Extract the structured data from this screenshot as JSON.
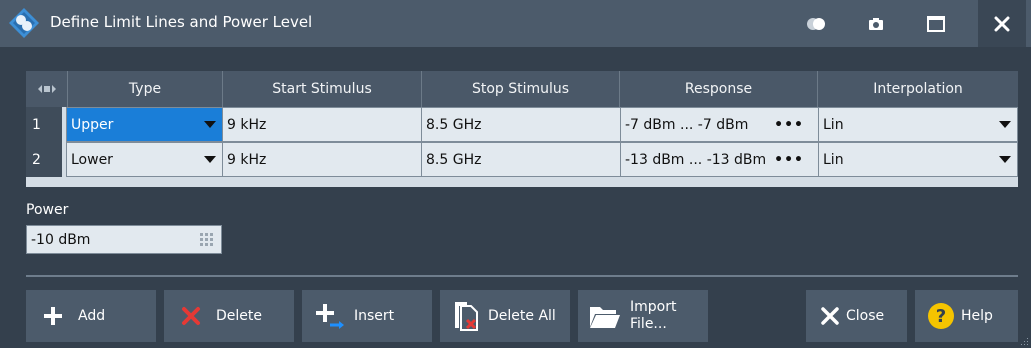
{
  "window": {
    "title": "Define Limit Lines and Power Level"
  },
  "table": {
    "columns": [
      "Type",
      "Start Stimulus",
      "Stop Stimulus",
      "Response",
      "Interpolation"
    ],
    "rows": [
      {
        "index": "1",
        "type": "Upper",
        "start": "9 kHz",
        "stop": "8.5 GHz",
        "response": "-7 dBm ... -7 dBm",
        "interpolation": "Lin"
      },
      {
        "index": "2",
        "type": "Lower",
        "start": "9 kHz",
        "stop": "8.5 GHz",
        "response": "-13 dBm ... -13 dBm",
        "interpolation": "Lin"
      }
    ],
    "response_more": "•••"
  },
  "power": {
    "label": "Power",
    "value": "-10 dBm"
  },
  "buttons": {
    "add": "Add",
    "delete": "Delete",
    "insert": "Insert",
    "delete_all": "Delete All",
    "import_line1": "Import",
    "import_line2": "File...",
    "close": "Close",
    "help": "Help"
  },
  "colors": {
    "selected_cell": "#1a7ed8",
    "delete_x": "#e53935",
    "help_circle": "#f5c400",
    "insert_arrow": "#1e90ff"
  }
}
